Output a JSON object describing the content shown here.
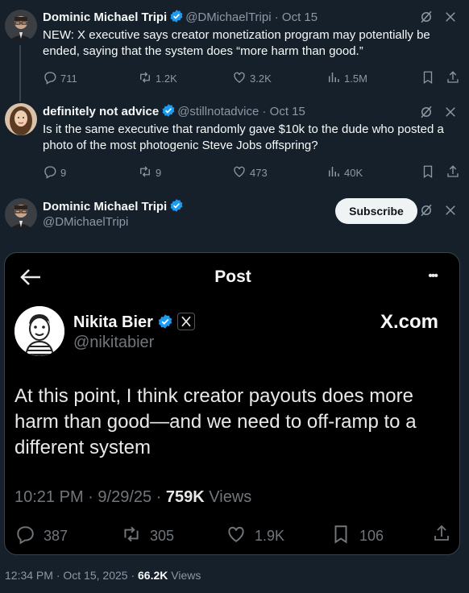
{
  "tweet1": {
    "name": "Dominic Michael Tripi",
    "handle": "@DMichaelTripi",
    "date": "Oct 15",
    "text": "NEW: X executive says creator monetization program may potentially be ended, saying that the system does “more harm than good.”",
    "replies": "711",
    "reposts": "1.2K",
    "likes": "3.2K",
    "views": "1.5M"
  },
  "tweet2": {
    "name": "definitely not advice",
    "handle": "@stillnotadvice",
    "date": "Oct 15",
    "text": "Is it the same executive that randomly gave $10k to the dude who posted a photo of the most photogenic Steve Jobs offspring?",
    "replies": "9",
    "reposts": "9",
    "likes": "473",
    "views": "40K"
  },
  "main": {
    "name": "Dominic Michael Tripi",
    "handle": "@DMichaelTripi",
    "subscribe_label": "Subscribe",
    "time": "12:34 PM",
    "date": "Oct 15, 2025",
    "views_count": "66.2K",
    "views_label": "Views"
  },
  "embed": {
    "title": "Post",
    "more": "•••",
    "name": "Nikita Bier",
    "handle": "@nikitabier",
    "site": "X.com",
    "text": "At this point, I think creator payouts does more harm than good—and we need to off-ramp to a different system",
    "time": "10:21 PM",
    "date": "9/29/25",
    "views_count": "759K",
    "views_label": "Views",
    "replies": "387",
    "reposts": "305",
    "likes": "1.9K",
    "bookmarks": "106"
  },
  "colors": {
    "background": "#15202b",
    "verified": "#1d9bf0",
    "muted": "#8b98a5"
  },
  "icons": [
    "reply-icon",
    "repost-icon",
    "like-icon",
    "views-icon",
    "bookmark-icon",
    "share-icon",
    "grok-icon",
    "verified-icon",
    "back-arrow-icon"
  ]
}
